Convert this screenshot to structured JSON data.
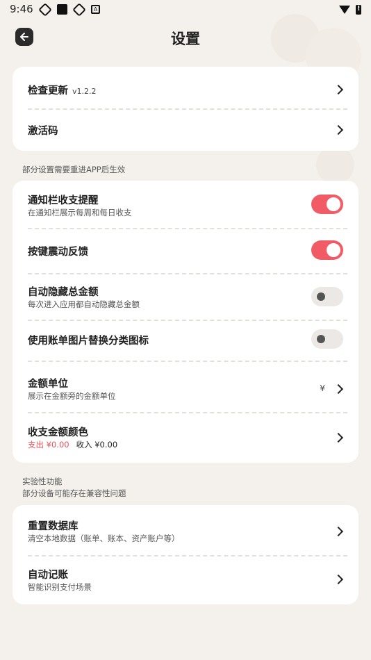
{
  "status_bar": {
    "time": "9:46"
  },
  "header": {
    "title": "设置"
  },
  "card1": {
    "check_update": {
      "label": "检查更新",
      "version": "v1.2.2"
    },
    "activation_code": {
      "label": "激活码"
    }
  },
  "note_restart": "部分设置需要重进APP后生效",
  "card2": {
    "notify": {
      "label": "通知栏收支提醒",
      "desc": "在通知栏展示每周和每日收支",
      "enabled": true
    },
    "haptic": {
      "label": "按键震动反馈",
      "enabled": true
    },
    "auto_hide": {
      "label": "自动隐藏总金额",
      "desc": "每次进入应用都自动隐藏总金额",
      "enabled": false
    },
    "bill_image": {
      "label": "使用账单图片替换分类图标",
      "enabled": false
    },
    "currency": {
      "label": "金额单位",
      "desc": "展示在金额旁的金额单位",
      "value": "¥"
    },
    "amount_color": {
      "label": "收支金额颜色",
      "expense": "支出 ¥0.00",
      "income": "收入 ¥0.00",
      "expense_color": "#e84f5a"
    }
  },
  "experimental": {
    "title": "实验性功能",
    "note": "部分设备可能存在兼容性问题"
  },
  "card3": {
    "reset_db": {
      "label": "重置数据库",
      "desc": "清空本地数据（账单、账本、资产账户等）"
    },
    "auto_record": {
      "label": "自动记账",
      "desc": "智能识别支付场景"
    }
  },
  "colors": {
    "accent": "#f05b66",
    "background": "#f4f1ec",
    "card": "#ffffff"
  }
}
